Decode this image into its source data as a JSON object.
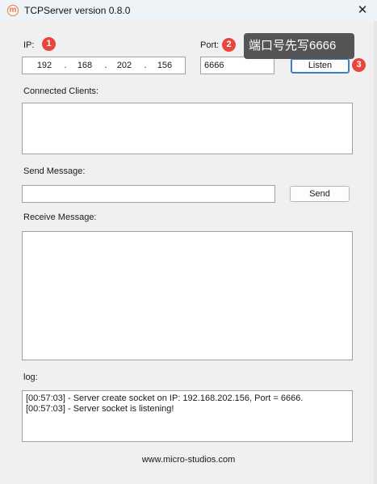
{
  "window": {
    "title": "TCPServer version 0.8.0",
    "app_icon": "m"
  },
  "ip": {
    "label": "IP:",
    "octets": [
      "192",
      "168",
      "202",
      "156"
    ],
    "separator": "."
  },
  "port": {
    "label": "Port:",
    "value": "6666"
  },
  "listen_button": "Listen",
  "connected_clients": {
    "label": "Connected Clients:"
  },
  "send_message": {
    "label": "Send Message:",
    "value": "",
    "button": "Send"
  },
  "receive_message": {
    "label": "Receive Message:"
  },
  "log": {
    "label": "log:",
    "lines": [
      "[00:57:03] - Server create socket on IP: 192.168.202.156, Port = 6666.",
      "[00:57:03] - Server socket is listening!"
    ]
  },
  "footer": "www.micro-studios.com",
  "annotations": {
    "marker1": "1",
    "marker2": "2",
    "marker3": "3",
    "tooltip": "端口号先写6666",
    "marker_color": "#e8453c"
  }
}
